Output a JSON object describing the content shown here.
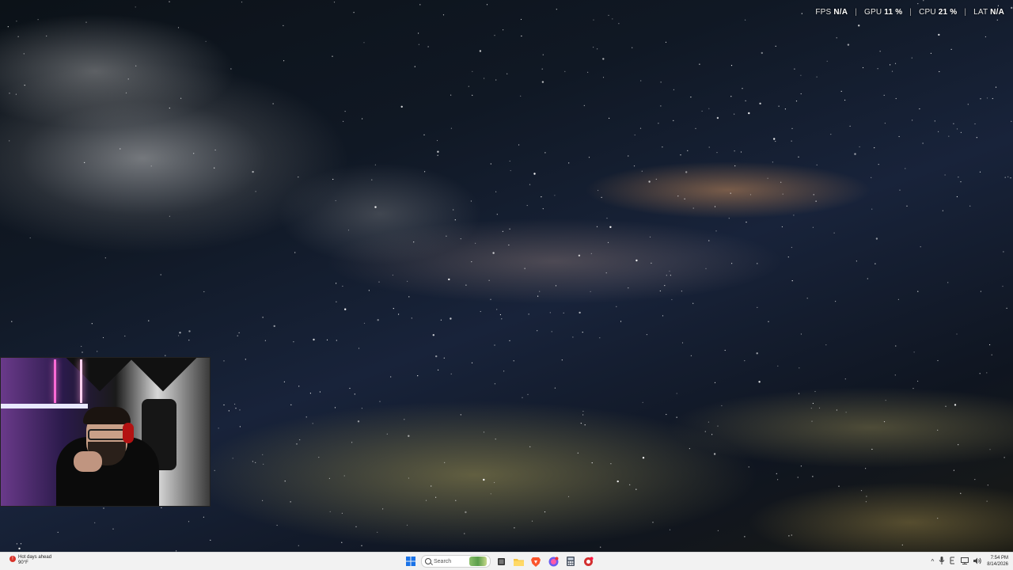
{
  "overlay": {
    "fps_label": "FPS",
    "fps_value": "N/A",
    "gpu_label": "GPU",
    "gpu_value": "11 %",
    "cpu_label": "CPU",
    "cpu_value": "21 %",
    "lat_label": "LAT",
    "lat_value": "N/A",
    "separator": "|"
  },
  "taskbar": {
    "weather": {
      "alert_badge": "!",
      "headline": "Hot days ahead",
      "temperature": "90°F"
    },
    "search_placeholder": "Search",
    "icons": [
      "windows-start-icon",
      "search-icon",
      "task-view-icon",
      "file-explorer-icon",
      "brave-browser-icon",
      "messenger-icon",
      "calculator-icon",
      "record-app-icon"
    ],
    "tray": {
      "chevron": "^",
      "clock_time": "7:54 PM",
      "clock_date": "8/14/2026"
    }
  },
  "colors": {
    "taskbar_bg": "#f2f2f2",
    "start_blue": "#1a73e8",
    "brave_orange": "#fb542b",
    "messenger_purple": "#a33bf2",
    "alert_red": "#d9342b"
  }
}
